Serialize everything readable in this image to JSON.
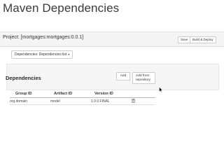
{
  "slide": {
    "title": "Maven Dependencies"
  },
  "project": {
    "title": "Project: [mortgages:mortgages:0.0.1]",
    "buttons": {
      "save": "Save",
      "build": "Build & Deploy"
    }
  },
  "view_dropdown": {
    "label": "Dependencies: Dependencies list",
    "caret": "▾"
  },
  "dependencies_panel": {
    "title": "Dependencies",
    "add_label": "Add",
    "add_from_repo_line1": "Add from",
    "add_from_repo_line2": "repository"
  },
  "table": {
    "headers": {
      "group_id": "Group ID",
      "artifact_id": "Artifact ID",
      "version_id": "Version ID"
    },
    "rows": [
      {
        "group_id": "org.domain",
        "artifact_id": "model",
        "version_id": "1.0.0.FINAL",
        "action_icon": "trash-icon"
      }
    ]
  },
  "icons": {
    "cursor": "mouse-pointer-icon",
    "delete": "trash-icon"
  }
}
